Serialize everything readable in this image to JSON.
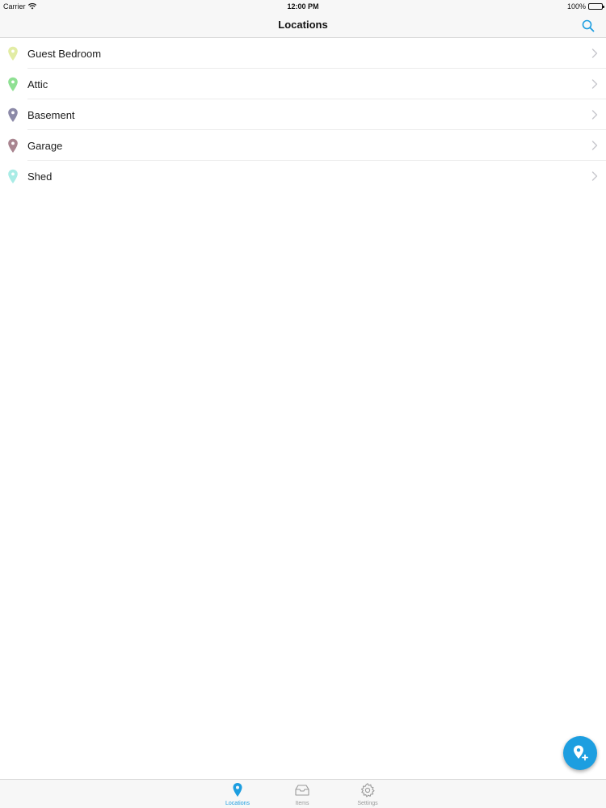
{
  "status_bar": {
    "carrier": "Carrier",
    "time": "12:00 PM",
    "battery": "100%"
  },
  "nav": {
    "title": "Locations",
    "search_icon": "search-icon"
  },
  "accent_color": "#1d9ee0",
  "locations": [
    {
      "label": "Guest Bedroom",
      "pin_color": "#e2eca4"
    },
    {
      "label": "Attic",
      "pin_color": "#8fe093"
    },
    {
      "label": "Basement",
      "pin_color": "#8c8aa8"
    },
    {
      "label": "Garage",
      "pin_color": "#a98590"
    },
    {
      "label": "Shed",
      "pin_color": "#a9ece6"
    }
  ],
  "fab": {
    "icon": "add-location-icon"
  },
  "tabs": [
    {
      "label": "Locations",
      "icon": "location-pin-icon",
      "active": true
    },
    {
      "label": "Items",
      "icon": "tray-icon",
      "active": false
    },
    {
      "label": "Settings",
      "icon": "gear-icon",
      "active": false
    }
  ]
}
